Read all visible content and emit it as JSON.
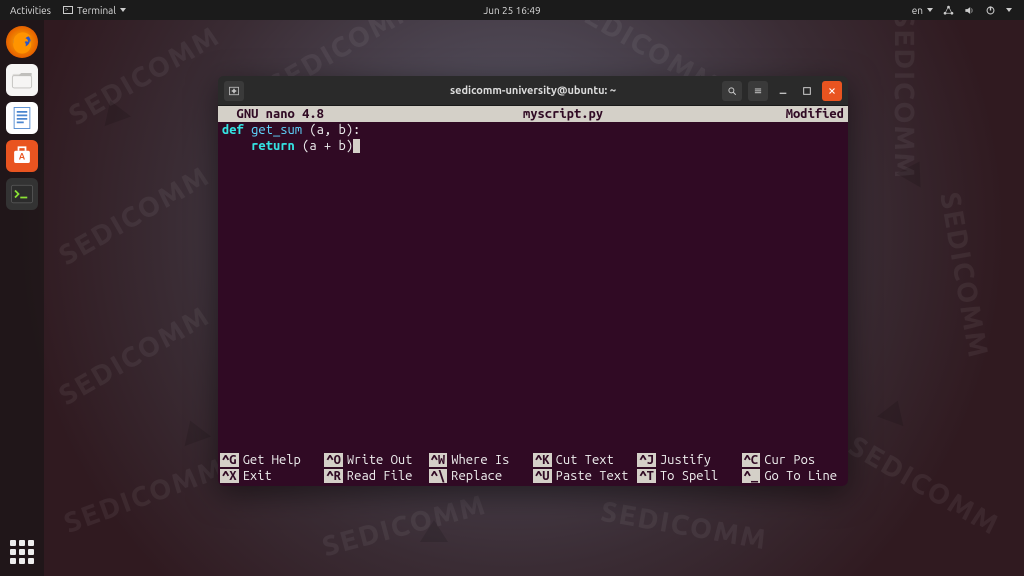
{
  "topbar": {
    "activities": "Activities",
    "terminal_menu": "Terminal",
    "datetime": "Jun 25  16:49",
    "lang": "en"
  },
  "window": {
    "title": "sedicomm-university@ubuntu: ~"
  },
  "nano": {
    "header_left": "  GNU nano 4.8",
    "header_center": "myscript.py",
    "header_right": "Modified",
    "code_line1_def": "def",
    "code_line1_name": " get_sum ",
    "code_line1_rest": "(a, b):",
    "code_line2_indent": "    ",
    "code_line2_return": "return",
    "code_line2_rest": " (a + b)",
    "footer": [
      {
        "key": "^G",
        "label": "Get Help"
      },
      {
        "key": "^O",
        "label": "Write Out"
      },
      {
        "key": "^W",
        "label": "Where Is"
      },
      {
        "key": "^K",
        "label": "Cut Text"
      },
      {
        "key": "^J",
        "label": "Justify"
      },
      {
        "key": "^C",
        "label": "Cur Pos"
      },
      {
        "key": "^X",
        "label": "Exit"
      },
      {
        "key": "^R",
        "label": "Read File"
      },
      {
        "key": "^\\",
        "label": "Replace"
      },
      {
        "key": "^U",
        "label": "Paste Text"
      },
      {
        "key": "^T",
        "label": "To Spell"
      },
      {
        "key": "^_",
        "label": "Go To Line"
      }
    ]
  }
}
